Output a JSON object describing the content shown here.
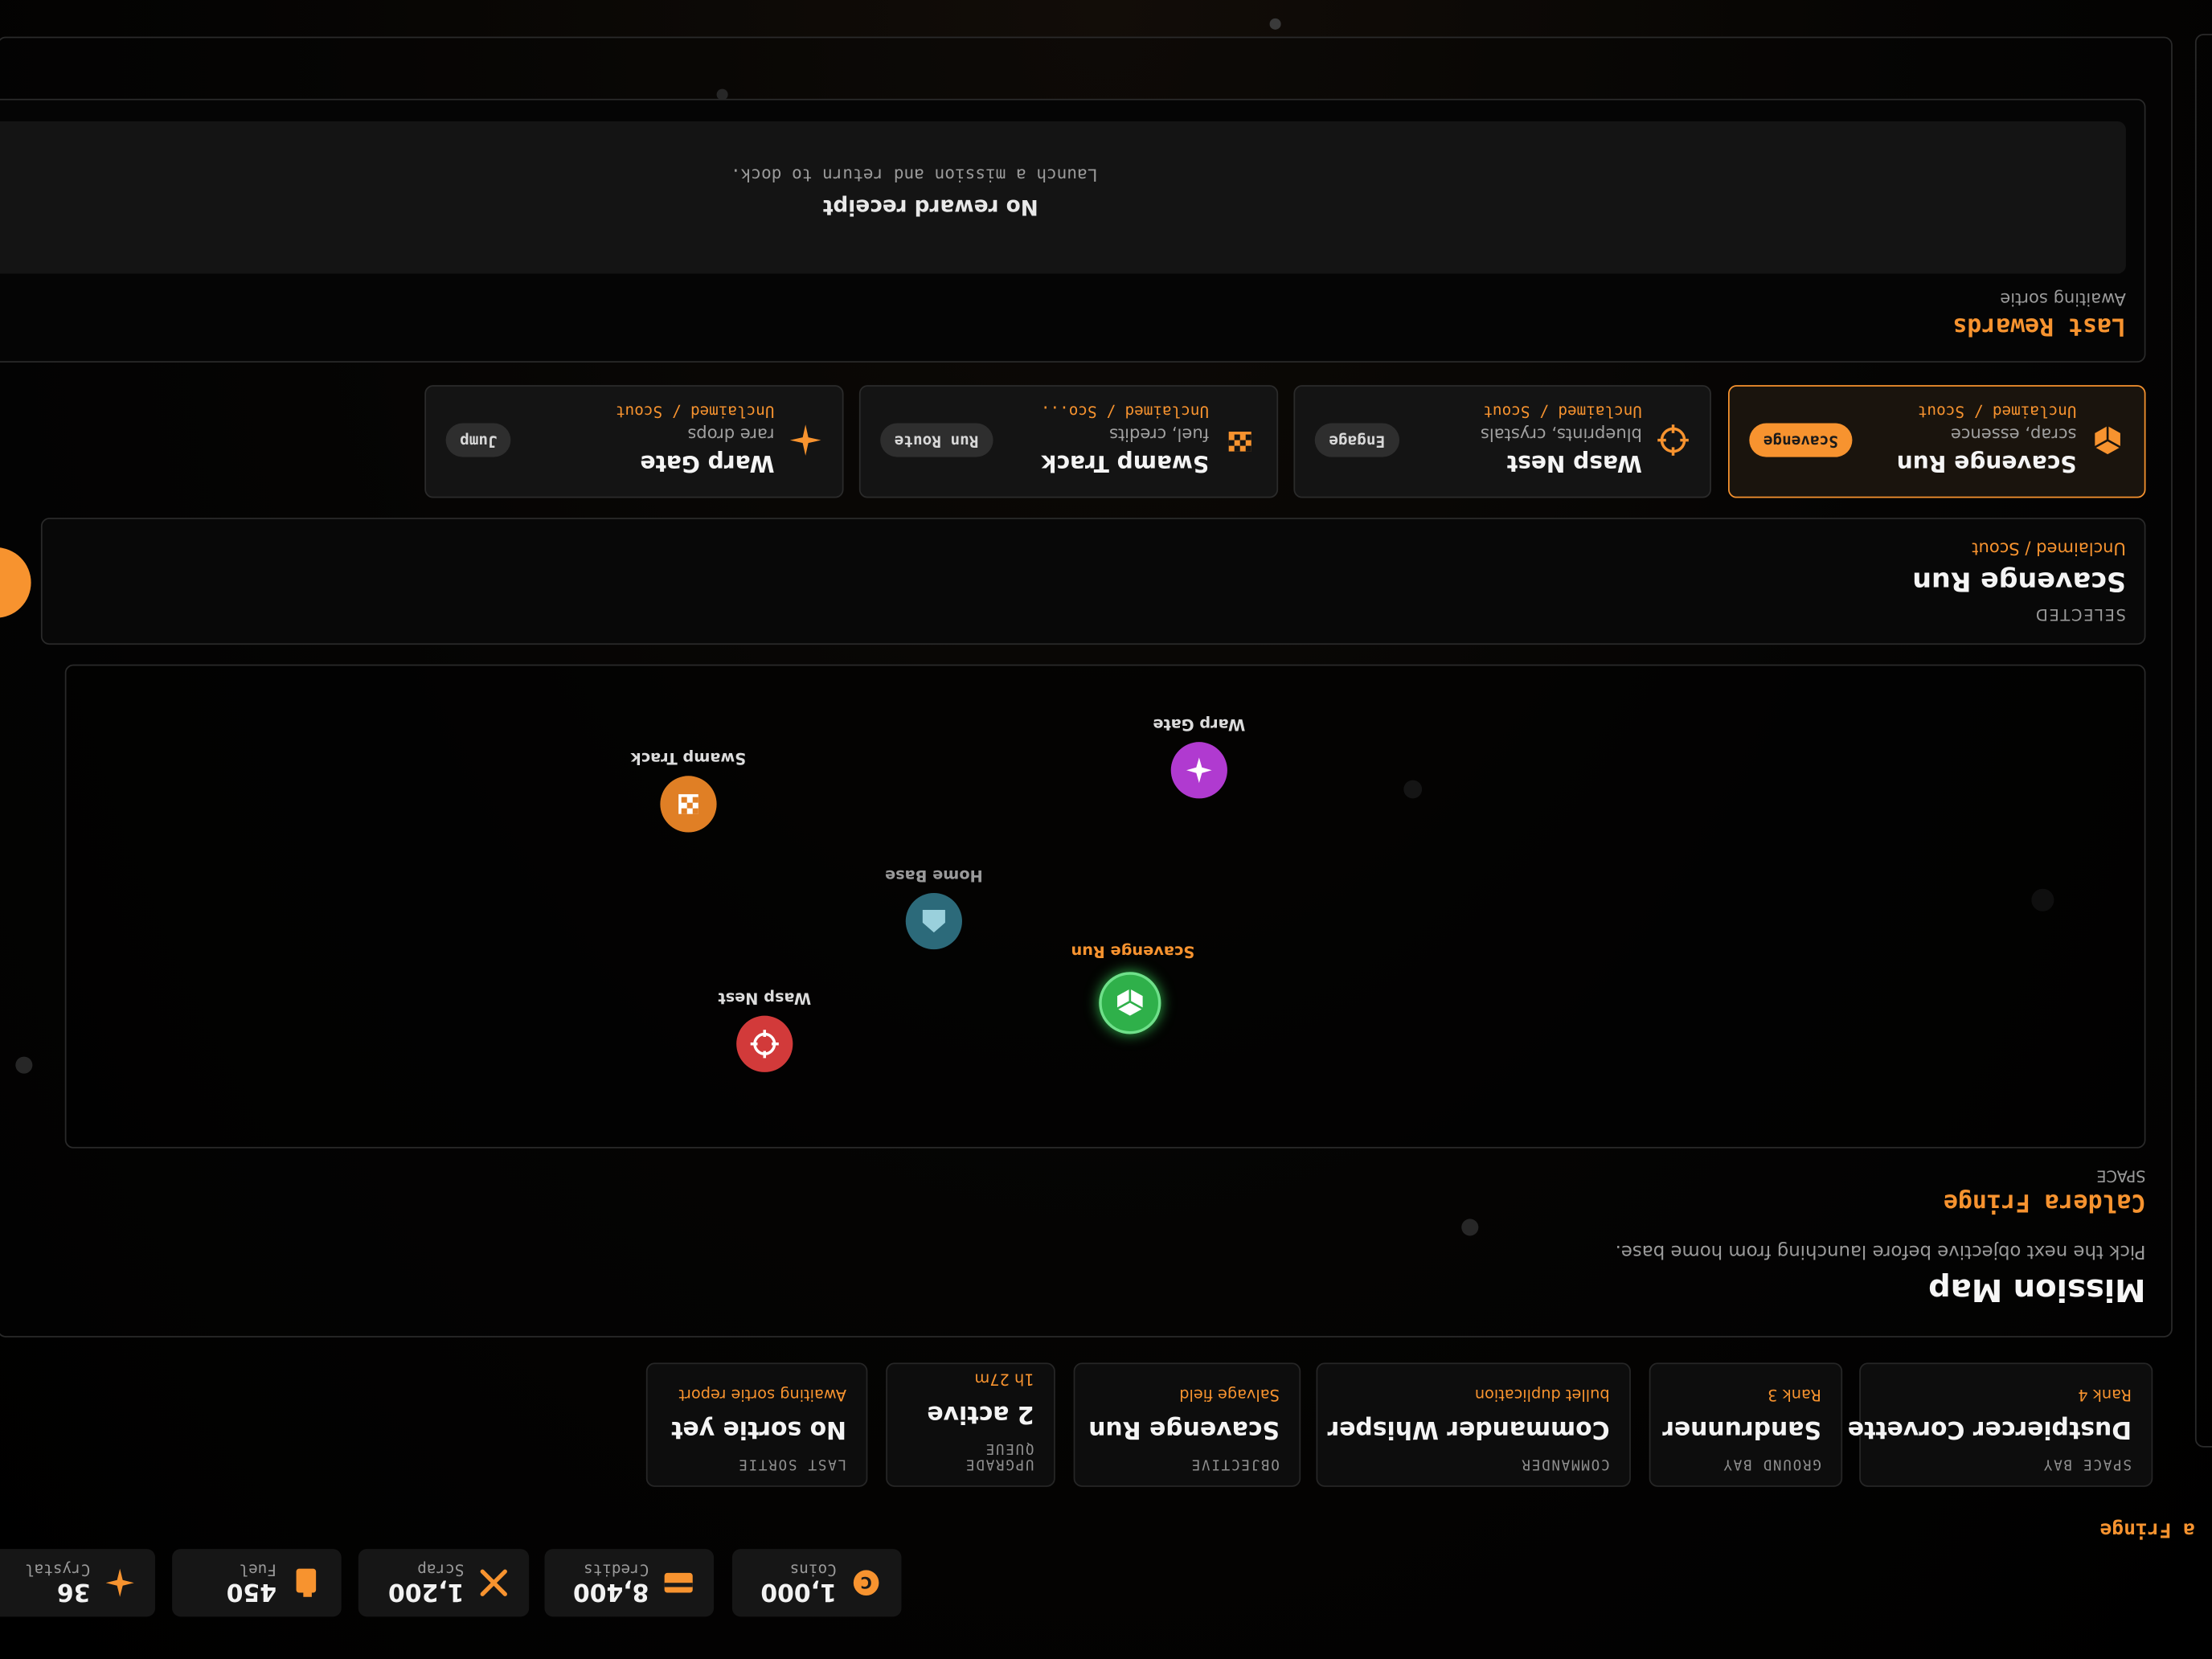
{
  "header": {
    "region_title_partial": "a Fringe"
  },
  "resources": [
    {
      "icon": "coin-icon",
      "value": "1,000",
      "label": "Coins"
    },
    {
      "icon": "credit-card-icon",
      "value": "8,400",
      "label": "Credits"
    },
    {
      "icon": "tools-icon",
      "value": "1,200",
      "label": "Scrap"
    },
    {
      "icon": "fuel-can-icon",
      "value": "450",
      "label": "Fuel"
    },
    {
      "icon": "sparkle-icon",
      "value": "36",
      "label": "Crystal"
    }
  ],
  "stats": [
    {
      "key": "SPACE BAY",
      "value": "Dustpiercer Corvette",
      "sub": "Rank 4"
    },
    {
      "key": "GROUND BAY",
      "value": "Sandrunner",
      "sub": "Rank 3"
    },
    {
      "key": "COMMANDER",
      "value": "Commander Whisper",
      "sub": "bullet duplication"
    },
    {
      "key": "OBJECTIVE",
      "value": "Scavenge Run",
      "sub": "Salvage field"
    },
    {
      "key": "UPGRADE QUEUE",
      "value": "2 active",
      "sub": "1h 27m"
    },
    {
      "key": "LAST SORTIE",
      "value": "No sortie yet",
      "sub": "Awaiting sortie report"
    }
  ],
  "mission_map": {
    "title": "Mission Map",
    "subtitle": "Pick the next objective before launching from home base.",
    "zone": "Caldera Fringe",
    "zone_type": "SPACE",
    "nodes": [
      {
        "name": "Scavenge Run",
        "icon": "cube-icon",
        "color": "#2fb04a",
        "highlight": true
      },
      {
        "name": "Wasp Nest",
        "icon": "crosshair-icon",
        "color": "#d23a3a",
        "highlight": false
      },
      {
        "name": "Home Base",
        "icon": "home-base-icon",
        "color": "#2c6a7a",
        "highlight": false
      },
      {
        "name": "Swamp Track",
        "icon": "checkered-flag-icon",
        "color": "#e07f25",
        "highlight": false
      },
      {
        "name": "Warp Gate",
        "icon": "sparkle-icon",
        "color": "#b03ad0",
        "highlight": false
      }
    ]
  },
  "selected": {
    "kicker": "SELECTED",
    "name": "Scavenge Run",
    "status": "Unclaimed / Scout"
  },
  "missions": [
    {
      "name": "Scavenge Run",
      "desc": "scrap, essence",
      "status": "Unclaimed / Scout",
      "action": "Scavenge",
      "icon": "cube-icon",
      "selected": true
    },
    {
      "name": "Wasp Nest",
      "desc": "blueprints, crystals",
      "status": "Unclaimed / Scout",
      "action": "Engage",
      "icon": "crosshair-icon",
      "selected": false
    },
    {
      "name": "Swamp Track",
      "desc": "fuel, credits",
      "status": "Unclaimed / Sco...",
      "action": "Run Route",
      "icon": "checkered-flag-icon",
      "selected": false
    },
    {
      "name": "Warp Gate",
      "desc": "rare drops",
      "status": "Unclaimed / Scout",
      "action": "Jump",
      "icon": "sparkle-icon",
      "selected": false
    }
  ],
  "rewards": {
    "title": "Last Rewards",
    "status": "Awaiting sortie",
    "empty_title": "No reward receipt",
    "empty_text": "Launch a mission and return to dock."
  },
  "colors": {
    "accent": "#f7932f",
    "panel": "#0d0d0d",
    "border": "#2a2a2a"
  }
}
